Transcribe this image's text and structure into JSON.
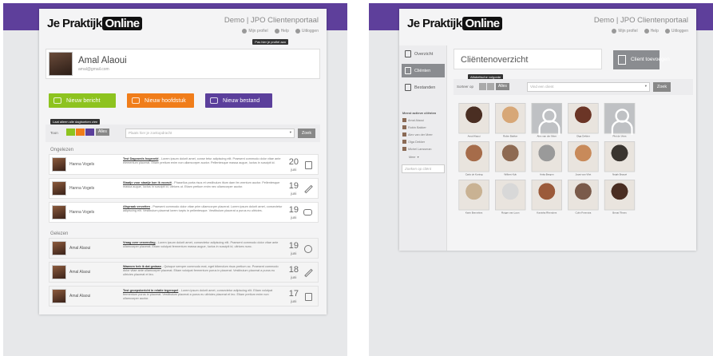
{
  "logo_text": "Je Praktijk",
  "logo_box": "Online",
  "portal_title": "Demo | JPO Clientenportaal",
  "top_links": [
    "Mijn profiel",
    "Help",
    "Uitloggen"
  ],
  "profile_tooltip": "Pas hier je profiel aan",
  "dashboard": {
    "user_name": "Amal Alaoui",
    "user_email": "amal@gmail.com",
    "actions": [
      {
        "label": "Nieuw bericht",
        "color": "#8dc31f"
      },
      {
        "label": "Nieuw hoofdstuk",
        "color": "#f07d1a"
      },
      {
        "label": "Nieuw bestand",
        "color": "#5b3f9b"
      }
    ],
    "filter_tooltip": "Laat alleen alle dagboeken zien",
    "show_label": "Toon",
    "all_label": "Alles",
    "search_placeholder": "Plaats hier je zoekopdracht",
    "search_button": "Zoek",
    "unread_label": "Ongelezen",
    "read_label": "Gelezen",
    "unread": [
      {
        "name": "Hanna Vogels",
        "title": "Test Dagvoeds hogeveld",
        "body": "Lorem ipsum dolorit amet, conse tetur adipiscing elit. Praesent commodo dolor vitae ante elementum placerat. Etiam pretium enim non ullamcorper auctor. Pellentesque massa augue, luctus in suscipit id.",
        "day": "20",
        "month": "juni"
      },
      {
        "name": "Hanna Vogels",
        "title": "Staatje voor staatje kon ik vooruit",
        "body": "Phasellus porta risus et vestibulum itium dam fer-mentum auctor. Pellentesque massa augue, luctus in suscipit id, ultrices ut. Etiam pretium enim nec ullamcorper auctor.",
        "day": "19",
        "month": "juni"
      },
      {
        "name": "Hanna Vogels",
        "title": "Afspraak verzetten",
        "body": "Praesent commodo dolor vitae prim ullamcorper placerat. Lorem ipsum dolorit amet, consectetur adipiscing elit. Vestibulum placerat lorem turpis in pellentesque. Vestibulum placerat a purus eu ultricies.",
        "day": "19",
        "month": "juni"
      }
    ],
    "read": [
      {
        "name": "Amal Alaoui",
        "title": "Vraag over verzending",
        "body": "Lorem ipsum dolorit amet, consectetur adipiscing elit. Praesent commodo dolor vitae ante ullamcorper placerat. Etiam volutpat fermentum massa augue, luctus in suscipit id, ultrices nunc.",
        "day": "19",
        "month": "juni"
      },
      {
        "name": "Amal Alaoui",
        "title": "Waarom heb ik dat gedaan",
        "body": "Quisque semper commodo erat, eget bibendum risus pretium ac. Praesent commodo dolor vitae ante ullamcorper placerat. Etiam volutpat fermentum purus in placerat. Vestibulum placerat a purus eu ultricies placerat et leo.",
        "day": "18",
        "month": "juni"
      },
      {
        "name": "Amal Alaoui",
        "title": "Test groepsbericht in relatie tegenspel",
        "body": "Lorem ipsum dolorit amet, consectetur adipiscing elit. Etiam volutpat fermentum purus in placerat. Vestibulum placerat a purus eu ultricies placerat et leo. Etiam pretium enim non ullamcorper auctor.",
        "day": "17",
        "month": "juni"
      }
    ]
  },
  "clients": {
    "sidebar": [
      {
        "label": "Overzicht"
      },
      {
        "label": "Cliënten"
      },
      {
        "label": "Bestanden"
      }
    ],
    "recent_title": "Meest actieve cliënten",
    "recent": [
      "Amal Alaoui",
      "Robin Bakker",
      "Alex van der Meer",
      "Olga Dekker",
      "Michel Lanssman"
    ],
    "more_label": "Meer",
    "sidebar_search": "Zoeken op cliënt",
    "page_title": "Cliëntenoverzicht",
    "add_button": "Client toevoegen",
    "sort_label": "Sorteer op",
    "sort_tooltip": "Alfabetische volgorde",
    "sort_all": "Alles",
    "search_placeholder": "Vind een client",
    "search_button": "Zoek",
    "tiles": [
      {
        "name": "Amal Alaoui",
        "color": "#4a2e22",
        "anon": false
      },
      {
        "name": "Robin Bakker",
        "color": "#d7a777",
        "anon": false
      },
      {
        "name": "Alex van der Meer",
        "color": "",
        "anon": true
      },
      {
        "name": "Olga Dekker",
        "color": "#6b3526",
        "anon": false
      },
      {
        "name": "Piet de Vries",
        "color": "",
        "anon": true
      },
      {
        "name": "Carlo de Koning",
        "color": "#a66c4a",
        "anon": false
      },
      {
        "name": "Wilbert Kok",
        "color": "#8e6a52",
        "anon": false
      },
      {
        "name": "Anita Bergen",
        "color": "#9a9a9a",
        "anon": false
      },
      {
        "name": "Joost van Vliet",
        "color": "#c88a5a",
        "anon": false
      },
      {
        "name": "Nejah Brouwi",
        "color": "#3a3530",
        "anon": false
      },
      {
        "name": "Karin Bennekes",
        "color": "#c9b293",
        "anon": false
      },
      {
        "name": "Rutger van Loon",
        "color": "#d8d8d8",
        "anon": false
      },
      {
        "name": "Kanisha Rhenders",
        "color": "#9b5a3a",
        "anon": false
      },
      {
        "name": "Colin Feenstra",
        "color": "#7a5a4a",
        "anon": false
      },
      {
        "name": "Benat Tilmes",
        "color": "#4a2e22",
        "anon": false
      }
    ]
  }
}
